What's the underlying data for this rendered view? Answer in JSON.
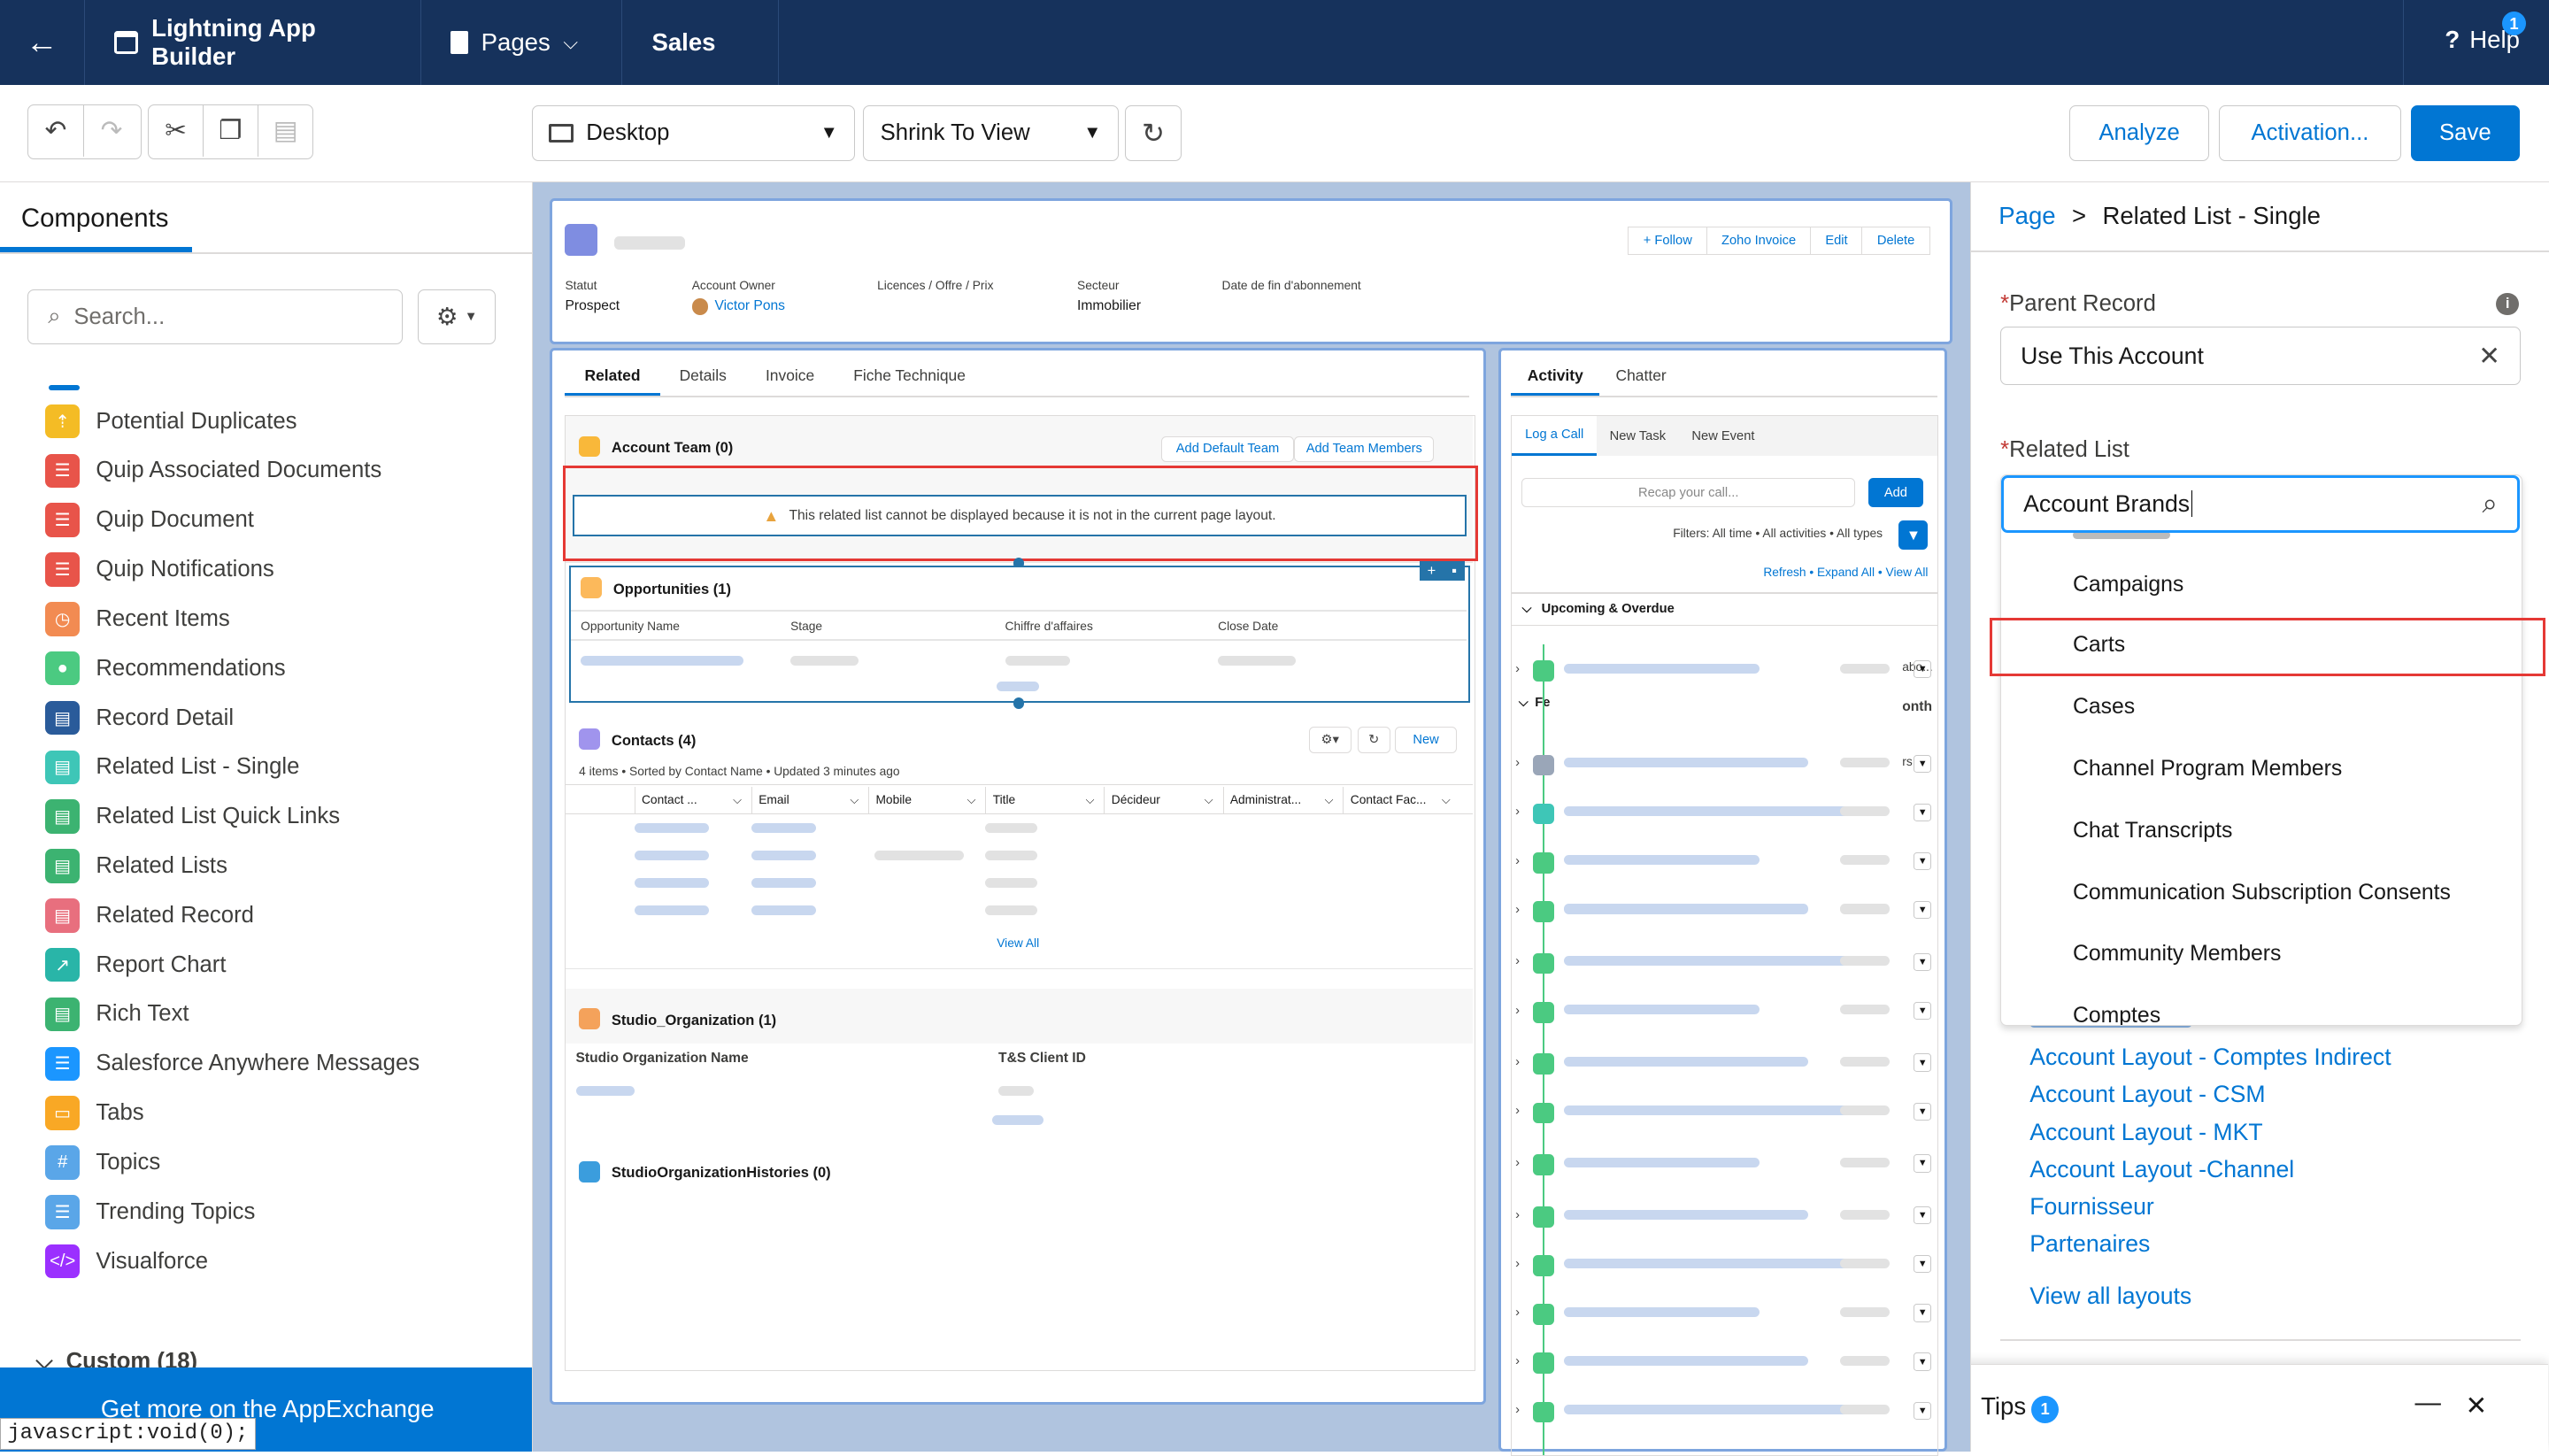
{
  "topnav": {
    "app_title": "Lightning App Builder",
    "pages_label": "Pages",
    "page_name": "Sales",
    "help_label": "Help",
    "help_badge": "1"
  },
  "toolbar": {
    "device": "Desktop",
    "view": "Shrink To View",
    "analyze": "Analyze",
    "activation": "Activation...",
    "save": "Save"
  },
  "components": {
    "tab_label": "Components",
    "search_placeholder": "Search...",
    "items": [
      {
        "label": "Potential Duplicates",
        "color": "#f4bc25",
        "glyph": "⇡"
      },
      {
        "label": "Quip Associated Documents",
        "color": "#e8544a",
        "glyph": "☰"
      },
      {
        "label": "Quip Document",
        "color": "#e8544a",
        "glyph": "☰"
      },
      {
        "label": "Quip Notifications",
        "color": "#e8544a",
        "glyph": "☰"
      },
      {
        "label": "Recent Items",
        "color": "#f28b52",
        "glyph": "◷"
      },
      {
        "label": "Recommendations",
        "color": "#4bca81",
        "glyph": "●"
      },
      {
        "label": "Record Detail",
        "color": "#2a5b9a",
        "glyph": "▤"
      },
      {
        "label": "Related List - Single",
        "color": "#3ec6b7",
        "glyph": "▤"
      },
      {
        "label": "Related List Quick Links",
        "color": "#3cb371",
        "glyph": "▤"
      },
      {
        "label": "Related Lists",
        "color": "#3cb371",
        "glyph": "▤"
      },
      {
        "label": "Related Record",
        "color": "#e86f7e",
        "glyph": "▤"
      },
      {
        "label": "Report Chart",
        "color": "#29b5a8",
        "glyph": "↗"
      },
      {
        "label": "Rich Text",
        "color": "#3cb371",
        "glyph": "▤"
      },
      {
        "label": "Salesforce Anywhere Messages",
        "color": "#1b96ff",
        "glyph": "☰"
      },
      {
        "label": "Tabs",
        "color": "#f9a825",
        "glyph": "▭"
      },
      {
        "label": "Topics",
        "color": "#5aa6e8",
        "glyph": "#"
      },
      {
        "label": "Trending Topics",
        "color": "#5aa6e8",
        "glyph": "☰"
      },
      {
        "label": "Visualforce",
        "color": "#9b30ff",
        "glyph": "</>"
      }
    ],
    "custom_header": "Custom (18)",
    "appexchange": "Get more on the AppExchange",
    "status_url": "javascript:void(0);"
  },
  "record": {
    "buttons": [
      "+ Follow",
      "Zoho Invoice",
      "Edit",
      "Delete"
    ],
    "fields": [
      {
        "label": "Statut",
        "value": "Prospect"
      },
      {
        "label": "Account Owner",
        "value": "Victor Pons"
      },
      {
        "label": "Licences / Offre / Prix",
        "value": ""
      },
      {
        "label": "Secteur",
        "value": "Immobilier"
      },
      {
        "label": "Date de fin d'abonnement",
        "value": ""
      }
    ]
  },
  "related_tabs": [
    "Related",
    "Details",
    "Invoice",
    "Fiche Technique"
  ],
  "account_team": {
    "title": "Account Team (0)",
    "btn1": "Add Default Team",
    "btn2": "Add Team Members",
    "warning": "This related list cannot be displayed because it is not in the current page layout."
  },
  "opportunities": {
    "title": "Opportunities (1)",
    "columns": [
      "Opportunity Name",
      "Stage",
      "Chiffre d'affaires",
      "Close Date"
    ]
  },
  "contacts": {
    "title": "Contacts (4)",
    "subtitle": "4 items • Sorted by Contact Name • Updated 3 minutes ago",
    "new_label": "New",
    "columns": [
      "Contact ...",
      "Email",
      "Mobile",
      "Title",
      "Décideur",
      "Administrat...",
      "Contact Fac..."
    ],
    "view_all": "View All"
  },
  "studio_org": {
    "title": "Studio_Organization (1)",
    "col1": "Studio Organization Name",
    "col2": "T&S Client ID"
  },
  "studio_hist": {
    "title": "StudioOrganizationHistories (0)"
  },
  "activity": {
    "tabs": [
      "Activity",
      "Chatter"
    ],
    "subtabs": [
      "Log a Call",
      "New Task",
      "New Event"
    ],
    "recap_placeholder": "Recap your call...",
    "add": "Add",
    "filters": "Filters: All time • All activities • All types",
    "links": "Refresh • Expand All • View All",
    "upcoming": "Upcoming & Overdue",
    "section2": "Fe",
    "month_fragment": "onth",
    "abo_fragment": "abo...",
    "rs_fragment": "rs"
  },
  "rightpanel": {
    "breadcrumb_root": "Page",
    "breadcrumb_sep": ">",
    "breadcrumb_current": "Related List - Single",
    "parent_record_label": "Parent Record",
    "parent_record_value": "Use This Account",
    "related_list_label": "Related List",
    "related_list_value": "Account Brands",
    "required_mark": "*",
    "dropdown_options": [
      "Campaigns",
      "Carts",
      "Cases",
      "Channel Program Members",
      "Chat Transcripts",
      "Communication Subscription Consents",
      "Community Members",
      "Comptes"
    ],
    "layout_links": [
      "Account Layout - Comptes Indirect",
      "Account Layout - CSM",
      "Account Layout - MKT",
      "Account Layout -Channel",
      "Fournisseur",
      "Partenaires"
    ],
    "view_all_layouts": "View all layouts",
    "tips_label": "Tips",
    "tips_badge": "1"
  },
  "colors": {
    "nav_bg": "#16325c",
    "brand": "#0176d3",
    "highlight_red": "#e53935"
  }
}
